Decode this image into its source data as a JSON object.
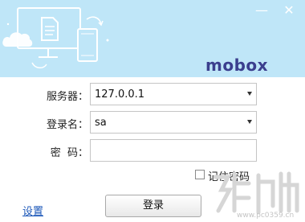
{
  "window": {
    "minimize_glyph": "—",
    "close_glyph": "✕"
  },
  "brand": {
    "logo_text": "mobox",
    "logo_color": "#3b3f8e",
    "banner_color": "#bfe6f8"
  },
  "form": {
    "server": {
      "label": "服务器：",
      "value": "127.0.0.1"
    },
    "login_name": {
      "label": "登录名：",
      "value": "sa"
    },
    "password": {
      "label": "密  码：",
      "value": ""
    },
    "remember_password": {
      "label": "记住密码",
      "checked": false
    }
  },
  "footer": {
    "settings_link": "设置",
    "login_button": "登录",
    "watermark_url": "www.pc0359.cn"
  }
}
